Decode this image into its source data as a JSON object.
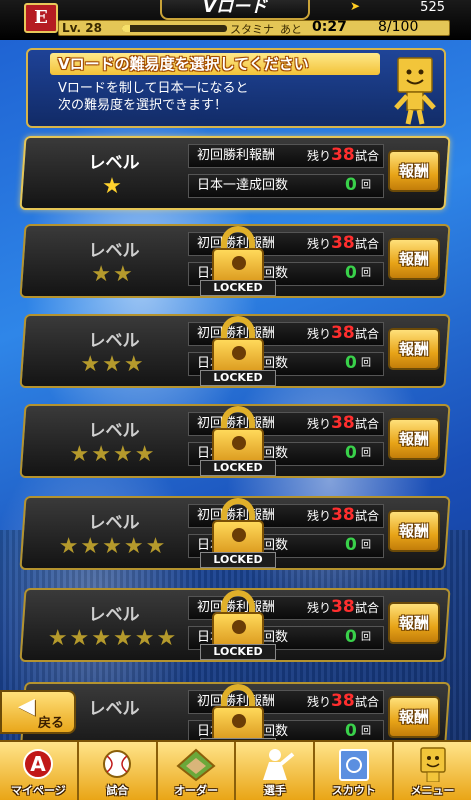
{
  "header": {
    "title": "Vロード",
    "coins": "525",
    "level": "Lv. 28",
    "stamina_label": "スタミナ",
    "stamina_fraction": 0.08,
    "time_prefix": "あと",
    "time_remaining": "0:27",
    "stamina_count": "8/100"
  },
  "banner": {
    "title": "Vロードの難易度を選択してください",
    "line1": "Vロードを制して日本一になると",
    "line2": "次の難易度を選択できます！"
  },
  "common": {
    "level_label": "レベル",
    "first_win_reward": "初回勝利報酬",
    "remaining_label": "残り",
    "games_unit": "試合",
    "champion_count_label": "日本一達成回数",
    "times_unit": "回",
    "reward_button": "報酬",
    "locked_text": "LOCKED"
  },
  "levels": [
    {
      "stars": "★",
      "remaining_games": "38",
      "champion_count": "0",
      "locked": false
    },
    {
      "stars": "★★",
      "remaining_games": "38",
      "champion_count": "0",
      "locked": true
    },
    {
      "stars": "★★★",
      "remaining_games": "38",
      "champion_count": "0",
      "locked": true
    },
    {
      "stars": "★★★★",
      "remaining_games": "38",
      "champion_count": "0",
      "locked": true
    },
    {
      "stars": "★★★★★",
      "remaining_games": "38",
      "champion_count": "0",
      "locked": true
    },
    {
      "stars": "★★★★★★",
      "remaining_games": "38",
      "champion_count": "0",
      "locked": true
    },
    {
      "stars": "",
      "remaining_games": "38",
      "champion_count": "0",
      "locked": true
    }
  ],
  "back_button": "戻る",
  "nav": [
    {
      "label": "マイページ",
      "icon": "my-page-icon"
    },
    {
      "label": "試合",
      "icon": "game-icon"
    },
    {
      "label": "オーダー",
      "icon": "order-icon"
    },
    {
      "label": "選手",
      "icon": "player-icon"
    },
    {
      "label": "スカウト",
      "icon": "scout-icon"
    },
    {
      "label": "メニュー",
      "icon": "menu-icon"
    }
  ]
}
